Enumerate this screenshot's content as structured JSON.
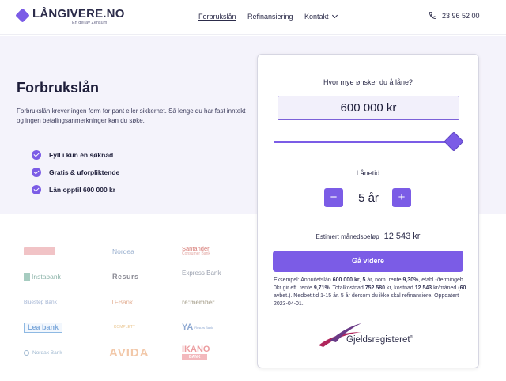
{
  "header": {
    "logo_name": "LÅNGIVERE.NO",
    "logo_sub": "En del av Zensum",
    "nav": [
      "Forbrukslån",
      "Refinansiering",
      "Kontakt"
    ],
    "phone": "23 96 52 00"
  },
  "hero": {
    "title": "Forbrukslån",
    "intro": "Forbrukslån krever ingen form for pant eller sikkerhet. Så lenge du har fast inntekt og ingen betalingsanmerkninger kan du søke.",
    "benefits": [
      "Fyll i kun én søknad",
      "Gratis & uforpliktende",
      "Lån opptil 600 000 kr"
    ]
  },
  "partners": {
    "sparebank": "",
    "nordea": "Nordea",
    "santander": "Santander",
    "santander_sub": "Consumer Bank",
    "instabank": "Instabank",
    "resurs": "Resurs",
    "express": "Express Bank",
    "bluestep": "Bluestep Bank",
    "tfbank": "TFBank",
    "remember": "re:member",
    "lea": "Lea bank",
    "komplett": "KOMPLETT",
    "ya": "YA",
    "ya_sub": "Resurs Bank",
    "nordax": "Nordax Bank",
    "avida": "AVIDA",
    "ikano": "IKANO",
    "ikano_bank": "BANK"
  },
  "calculator": {
    "question": "Hvor mye ønsker du å låne?",
    "amount": "600 000 kr",
    "slider_fraction": 1.0,
    "term_label": "Lånetid",
    "term_value": "5 år",
    "minus": "−",
    "plus": "+",
    "monthly_label": "Estimert månedsbeløp",
    "monthly_value": "12 543 kr",
    "cta": "Gå videre",
    "disclaimer": {
      "p1": "Eksempel: Annuitetslån ",
      "b1": "600 000 kr",
      "p2": ", ",
      "b2": "5",
      "p3": " år, nom. rente ",
      "b3": "9,30%",
      "p4": ", etabl.-/termingeb. 0kr gir eff. rente ",
      "b4": "9,71%",
      "p5": ". Totalkostnad ",
      "b5": "752 580",
      "p6": " kr, kostnad ",
      "b6": "12 543",
      "p7": " kr/måned (",
      "b7": "60",
      "p8": " avbet.). Nedbet.tid 1-15 år. 5 år dersom du ikke skal refinansiere. Oppdatert 2023-04-01."
    },
    "gjelds": "Gjeldsregisteret",
    "gjelds_mark": "®"
  },
  "colors": {
    "accent": "#7b5ce6",
    "hero_bg": "#f4f3fb"
  }
}
